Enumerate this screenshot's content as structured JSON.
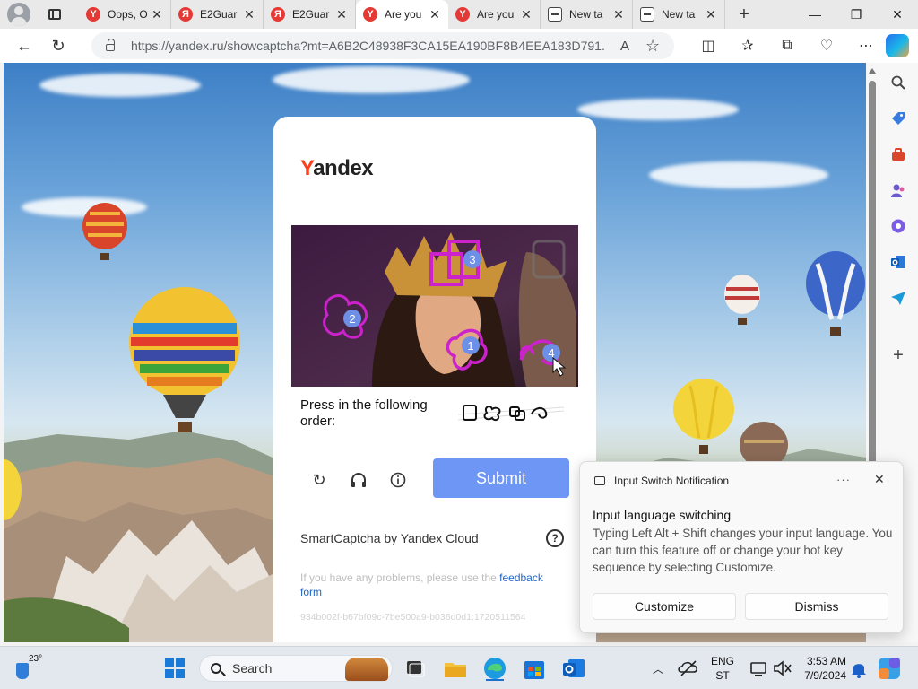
{
  "tabs": [
    {
      "favicon": "yandex-y-icon",
      "title": "Oops, O",
      "active": false
    },
    {
      "favicon": "yandex-ya-icon",
      "title": "E2Guar",
      "active": false
    },
    {
      "favicon": "yandex-ya-icon",
      "title": "E2Guar",
      "active": false
    },
    {
      "favicon": "yandex-y-icon",
      "title": "Are you",
      "active": true
    },
    {
      "favicon": "yandex-y-icon",
      "title": "Are you",
      "active": false
    },
    {
      "favicon": "new-tab-icon",
      "title": "New ta",
      "active": false
    },
    {
      "favicon": "new-tab-icon",
      "title": "New ta",
      "active": false
    }
  ],
  "address_bar": {
    "url": "https://yandex.ru/showcaptcha?mt=A6B2C48938F3CA15EA190BF8B4EEA183D791..."
  },
  "captcha": {
    "logo_first": "Y",
    "logo_rest": "andex",
    "order_text": "Press in the following order:",
    "markers": [
      "1",
      "2",
      "3",
      "4"
    ],
    "submit_label": "Submit",
    "brand_text": "SmartCaptcha by Yandex Cloud",
    "help_glyph": "?",
    "problems_prefix": "If you have any problems, please use the ",
    "problems_link": "feedback form",
    "hash": "934b002f-b67bf09c-7be500a9-b036d0d1:1720511564"
  },
  "notification": {
    "header": "Input Switch Notification",
    "title": "Input language switching",
    "body": "Typing Left Alt + Shift changes your input language. You can turn this feature off or change your hot key sequence by selecting Customize.",
    "customize_label": "Customize",
    "dismiss_label": "Dismiss"
  },
  "taskbar": {
    "temperature": "23°",
    "search_label": "Search",
    "lang_line1": "ENG",
    "lang_line2": "ST",
    "time": "3:53 AM",
    "date": "7/9/2024"
  },
  "colors": {
    "yandex_red": "#fc3f1d",
    "submit_blue": "#6e96f5",
    "link_blue": "#2266c8",
    "marker_magenta": "#cc22cc"
  }
}
